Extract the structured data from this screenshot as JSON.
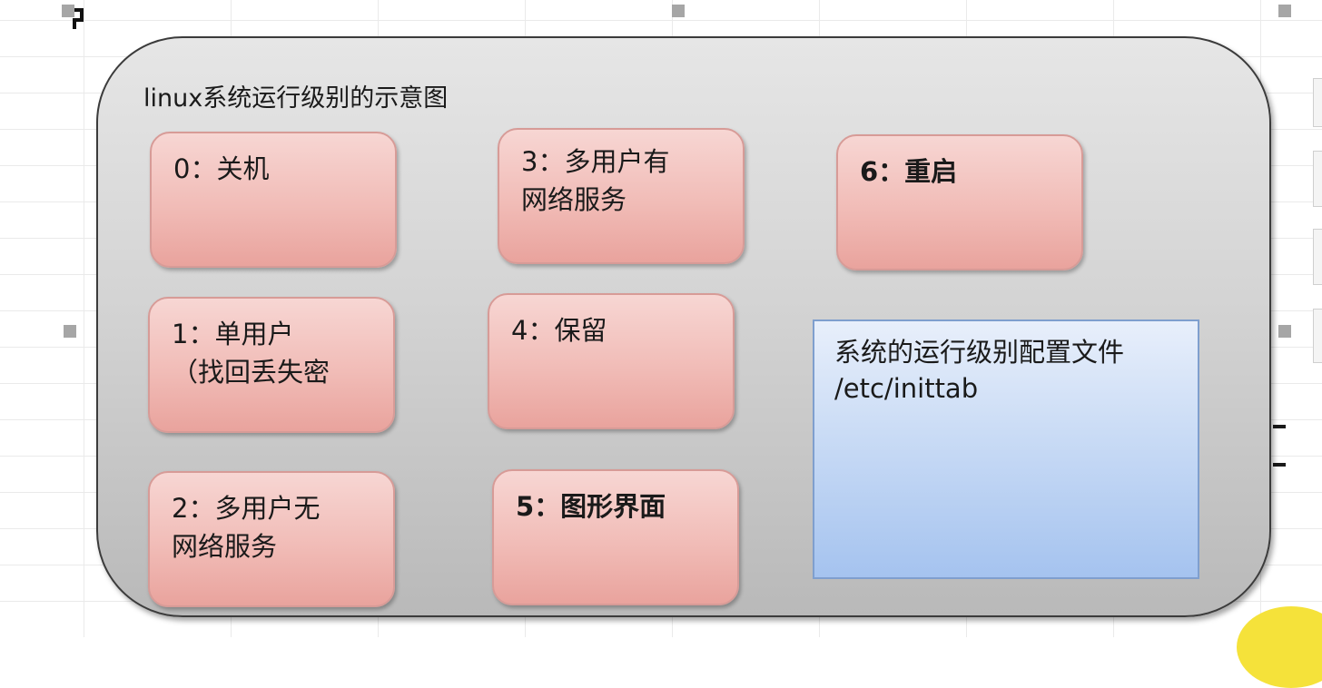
{
  "diagram": {
    "title": "linux系统运行级别的示意图",
    "levels": [
      {
        "id": 0,
        "text": "0：关机"
      },
      {
        "id": 1,
        "text": "1：单用户\n（找回丢失密"
      },
      {
        "id": 2,
        "text": "2：多用户无\n网络服务"
      },
      {
        "id": 3,
        "text": "3：多用户有\n网络服务"
      },
      {
        "id": 4,
        "text": "4：保留"
      },
      {
        "id": 5,
        "text": "5：图形界面"
      },
      {
        "id": 6,
        "text": "6：重启"
      }
    ],
    "config_note": {
      "text": "系统的运行级别配置文件\n/etc/inittab"
    }
  },
  "colors": {
    "level_box": "#f1bcb7",
    "config_box": "#c9dbf5",
    "outer_panel": "#d4d4d4"
  }
}
